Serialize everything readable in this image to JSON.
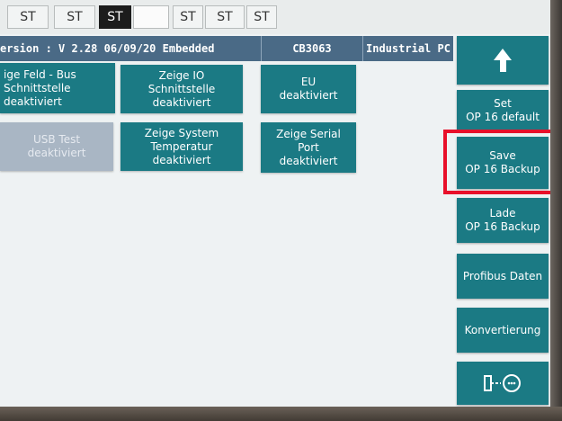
{
  "topbar": {
    "tabs": [
      {
        "label": "ST",
        "state": "normal"
      },
      {
        "label": "ST",
        "state": "normal"
      },
      {
        "label": "ST",
        "state": "active"
      },
      {
        "label": "",
        "state": "blank"
      },
      {
        "label": "ST",
        "state": "normal"
      },
      {
        "label": "ST",
        "state": "normal"
      },
      {
        "label": "ST",
        "state": "normal"
      }
    ]
  },
  "infobar": {
    "version": "ersion : V 2.28 06/09/20  Embedded",
    "device": "CB3063",
    "type": "Industrial PC"
  },
  "tiles": [
    {
      "line1": "ige Feld - Bus",
      "line2": "Schnittstelle",
      "line3": "deaktiviert"
    },
    {
      "line1": "Zeige IO",
      "line2": "Schnittstelle",
      "line3": "deaktiviert"
    },
    {
      "line1": "EU",
      "line2": "deaktiviert"
    },
    {
      "line1": "USB Test",
      "line2": "deaktiviert"
    },
    {
      "line1": "Zeige System",
      "line2": "Temperatur",
      "line3": "deaktiviert"
    },
    {
      "line1": "Zeige Serial",
      "line2": "Port",
      "line3": "deaktiviert"
    }
  ],
  "sidebar": {
    "set": {
      "line1": "Set",
      "line2": "OP 16 default"
    },
    "save": {
      "line1": "Save",
      "line2": "OP 16 Backup"
    },
    "lade": {
      "line1": "Lade",
      "line2": "OP 16 Backup"
    },
    "profibus": "Profibus Daten",
    "konvertierung": "Konvertierung"
  },
  "icons": {
    "up": "arrow-up-icon",
    "network": "network-connection-icon"
  },
  "colors": {
    "teal": "#1b7a84",
    "infobar": "#4a6a86",
    "disabled": "#a9b6c4",
    "highlight": "#e8102a"
  }
}
